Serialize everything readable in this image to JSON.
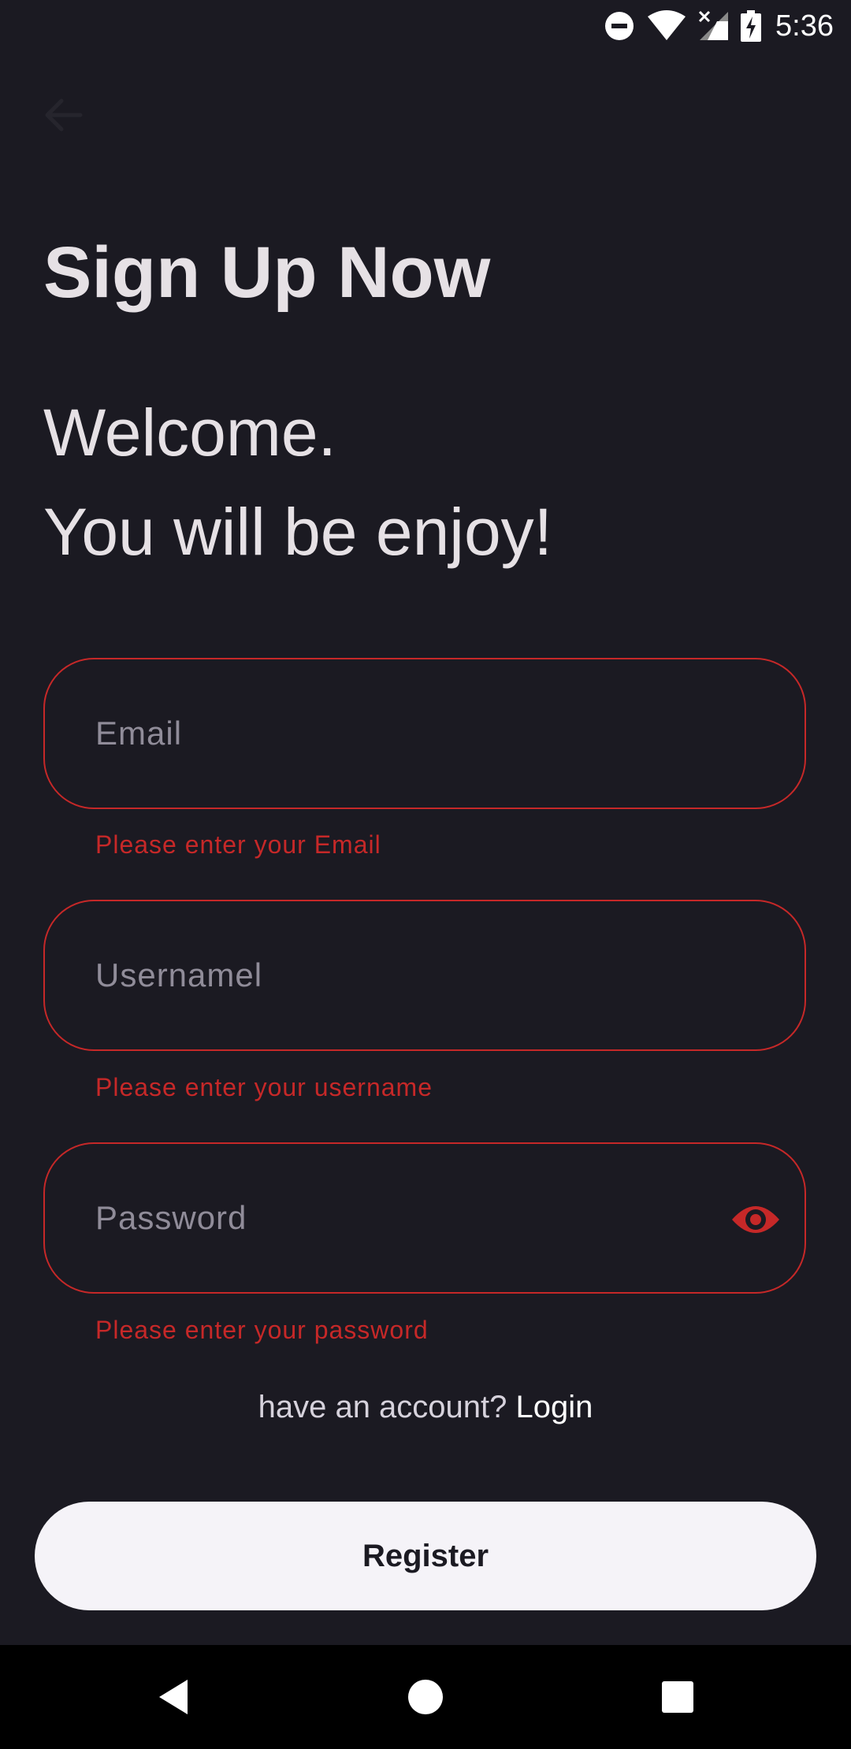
{
  "status_bar": {
    "time": "5:36",
    "icons": [
      "do-not-disturb-icon",
      "wifi-icon",
      "cell-signal-off-icon",
      "battery-charging-icon"
    ]
  },
  "header": {
    "back_icon": "arrow-left-icon"
  },
  "title": "Sign Up Now",
  "welcome_line1": "Welcome.",
  "welcome_line2": "You will be enjoy!",
  "form": {
    "email": {
      "placeholder": "Email",
      "value": "",
      "error": "Please enter your Email"
    },
    "username": {
      "placeholder": "Usernamel",
      "value": "",
      "error": "Please enter your username"
    },
    "password": {
      "placeholder": "Password",
      "value": "",
      "error": "Please enter your password",
      "toggle_icon": "eye-icon"
    }
  },
  "login_prompt": "have an account?",
  "login_link": "Login",
  "register_label": "Register",
  "nav_bar": {
    "icons": [
      "back-triangle-icon",
      "home-circle-icon",
      "recents-square-icon"
    ]
  },
  "colors": {
    "background": "#1b1a22",
    "error": "#c62828",
    "text": "#e6e1e5",
    "button_bg": "#f5f3f8"
  }
}
